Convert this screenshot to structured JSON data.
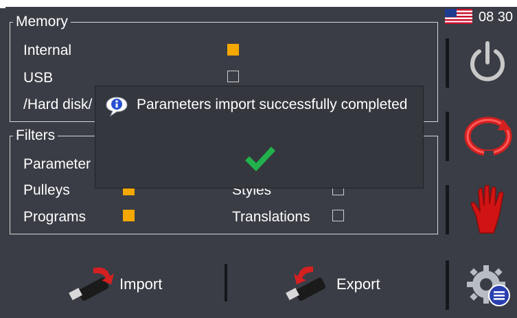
{
  "status": {
    "time": "08 30",
    "flag_icon": "us-flag-icon"
  },
  "memory": {
    "title": "Memory",
    "items": [
      {
        "label": "Internal",
        "checked": true
      },
      {
        "label": "USB",
        "checked": false
      },
      {
        "label": "/Hard disk/",
        "checked": false
      }
    ]
  },
  "filters": {
    "title": "Filters",
    "items": [
      {
        "label": "Parameter",
        "checked": true
      },
      {
        "label": "Pulleys",
        "checked": true
      },
      {
        "label": "Programs",
        "checked": true
      },
      {
        "label": "Styles",
        "checked": false
      },
      {
        "label": "Translations",
        "checked": false
      }
    ]
  },
  "dialog": {
    "message": "Parameters import successfully completed"
  },
  "actions": {
    "import_label": "Import",
    "export_label": "Export"
  },
  "colors": {
    "checked": "#f5a800",
    "background": "#3a3d45",
    "check_green": "#22b14c"
  }
}
